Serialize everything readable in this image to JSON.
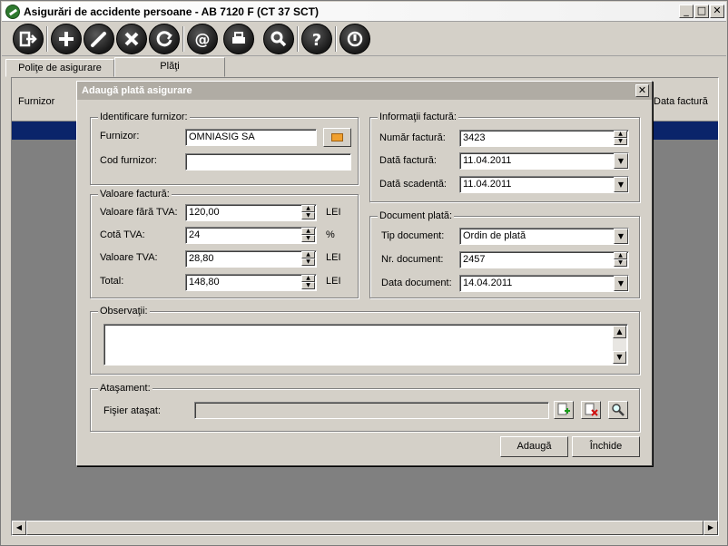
{
  "window": {
    "title": "Asigurări de accidente persoane - AB 7120 F (CT 37 SCT)",
    "min": "_",
    "max": "□",
    "close": "✕"
  },
  "toolbar": {
    "buttons": [
      "exit-icon",
      "add-icon",
      "edit-icon",
      "delete-icon",
      "refresh-icon",
      "email-icon",
      "print-icon",
      "search-icon",
      "help-icon",
      "power-icon"
    ]
  },
  "tabs": [
    {
      "label": "Poliţe de asigurare"
    },
    {
      "label": "Plăţi"
    }
  ],
  "grid": {
    "col_furnizor": "Furnizor",
    "col_data_factura": "Data factură"
  },
  "dialog": {
    "title": "Adaugă plată asigurare",
    "close": "✕",
    "identificare": {
      "group_label": "Identificare furnizor:",
      "furnizor_label": "Furnizor:",
      "furnizor_value": "OMNIASIG SA",
      "cod_label": "Cod furnizor:",
      "cod_value": ""
    },
    "valoare": {
      "group_label": "Valoare factură:",
      "fara_tva_label": "Valoare fără TVA:",
      "fara_tva_value": "120,00",
      "fara_tva_unit": "LEI",
      "cota_label": "Cotă TVA:",
      "cota_value": "24",
      "cota_unit": "%",
      "tva_label": "Valoare TVA:",
      "tva_value": "28,80",
      "tva_unit": "LEI",
      "total_label": "Total:",
      "total_value": "148,80",
      "total_unit": "LEI"
    },
    "informatii": {
      "group_label": "Informaţii factură:",
      "numar_label": "Număr factură:",
      "numar_value": "3423",
      "data_label": "Dată factură:",
      "data_value": "11.04.2011",
      "scadenta_label": "Dată scadentă:",
      "scadenta_value": "11.04.2011"
    },
    "document": {
      "group_label": "Document plată:",
      "tip_label": "Tip document:",
      "tip_value": "Ordin de plată",
      "nr_label": "Nr. document:",
      "nr_value": "2457",
      "data_label": "Data document:",
      "data_value": "14.04.2011"
    },
    "observatii": {
      "group_label": "Observaţii:",
      "value": ""
    },
    "atasament": {
      "group_label": "Ataşament:",
      "fisier_label": "Fişier ataşat:",
      "fisier_value": ""
    },
    "buttons": {
      "adauga": "Adaugă",
      "inchide": "Închide"
    }
  },
  "colors": {
    "selection": "#0a246a",
    "face": "#d4d0c8",
    "grid_bg": "#808080"
  }
}
